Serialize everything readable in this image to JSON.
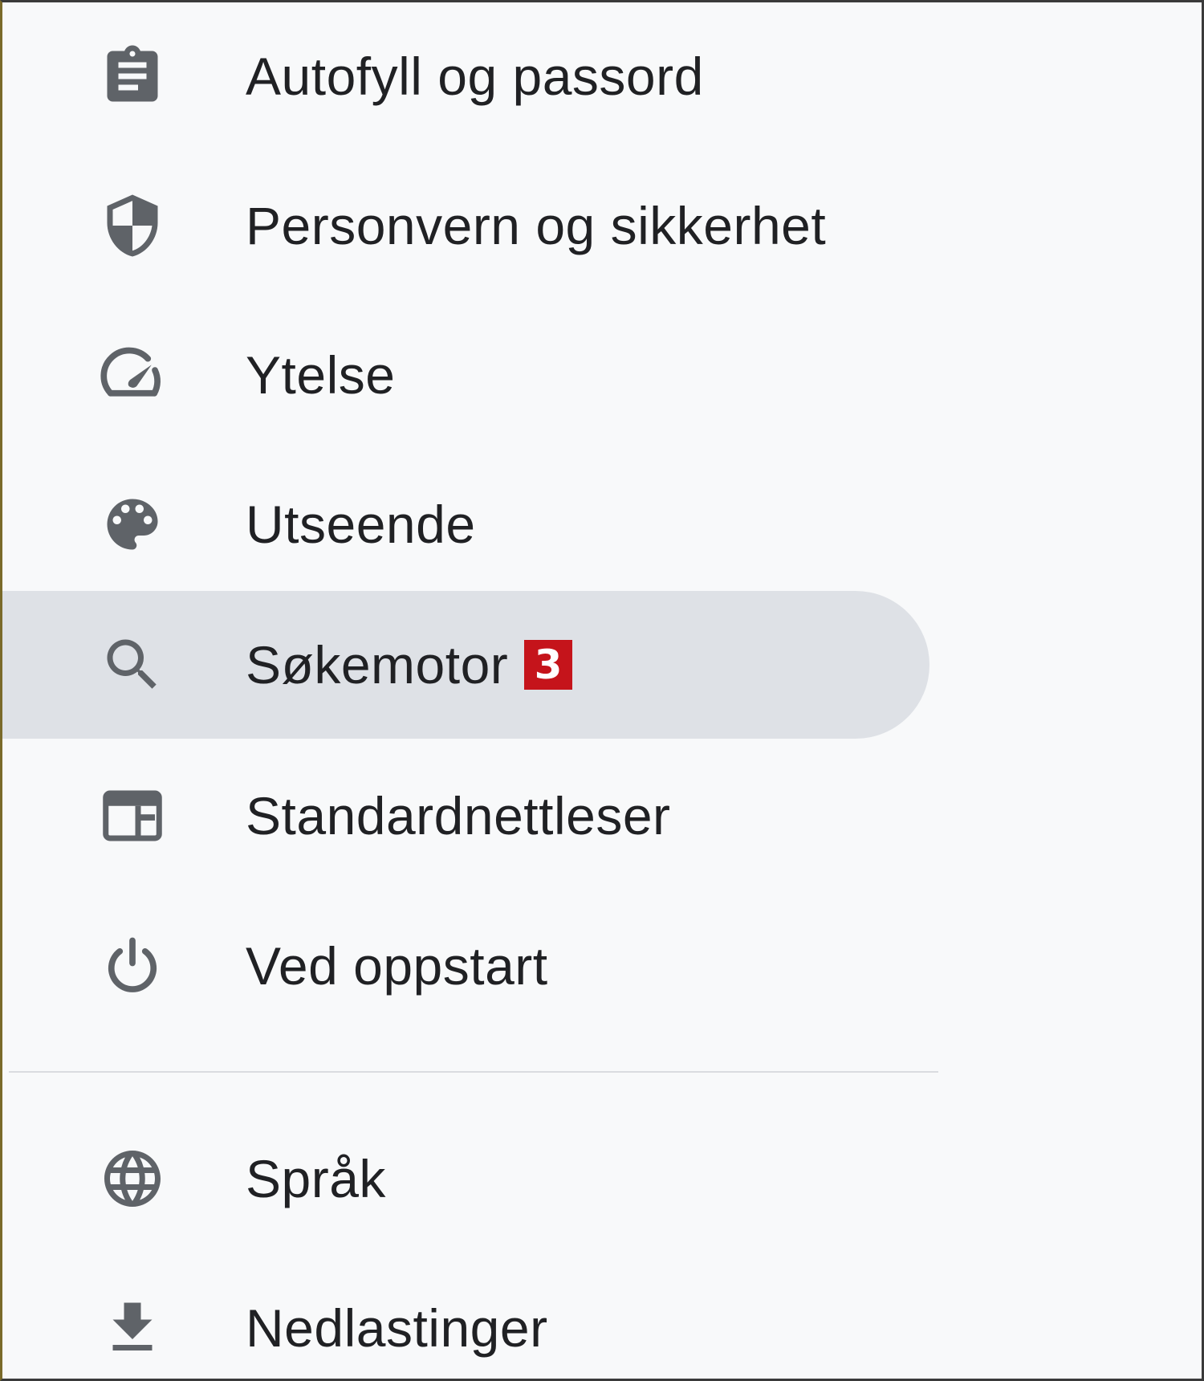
{
  "settings_nav": {
    "items": [
      {
        "label": "Autofyll og passord",
        "icon": "clipboard-icon"
      },
      {
        "label": "Personvern og sikkerhet",
        "icon": "shield-icon"
      },
      {
        "label": "Ytelse",
        "icon": "speedometer-icon"
      },
      {
        "label": "Utseende",
        "icon": "palette-icon"
      },
      {
        "label": "Søkemotor",
        "icon": "search-icon",
        "selected": true,
        "badge": "3"
      },
      {
        "label": "Standardnettleser",
        "icon": "browser-window-icon"
      },
      {
        "label": "Ved oppstart",
        "icon": "power-icon"
      },
      {
        "label": "Språk",
        "icon": "globe-icon"
      },
      {
        "label": "Nedlastinger",
        "icon": "download-icon"
      }
    ]
  },
  "colors": {
    "background": "#f8f9fa",
    "selected_background": "#dee1e6",
    "icon": "#5f6368",
    "text": "#202124",
    "badge": "#c5141b"
  }
}
